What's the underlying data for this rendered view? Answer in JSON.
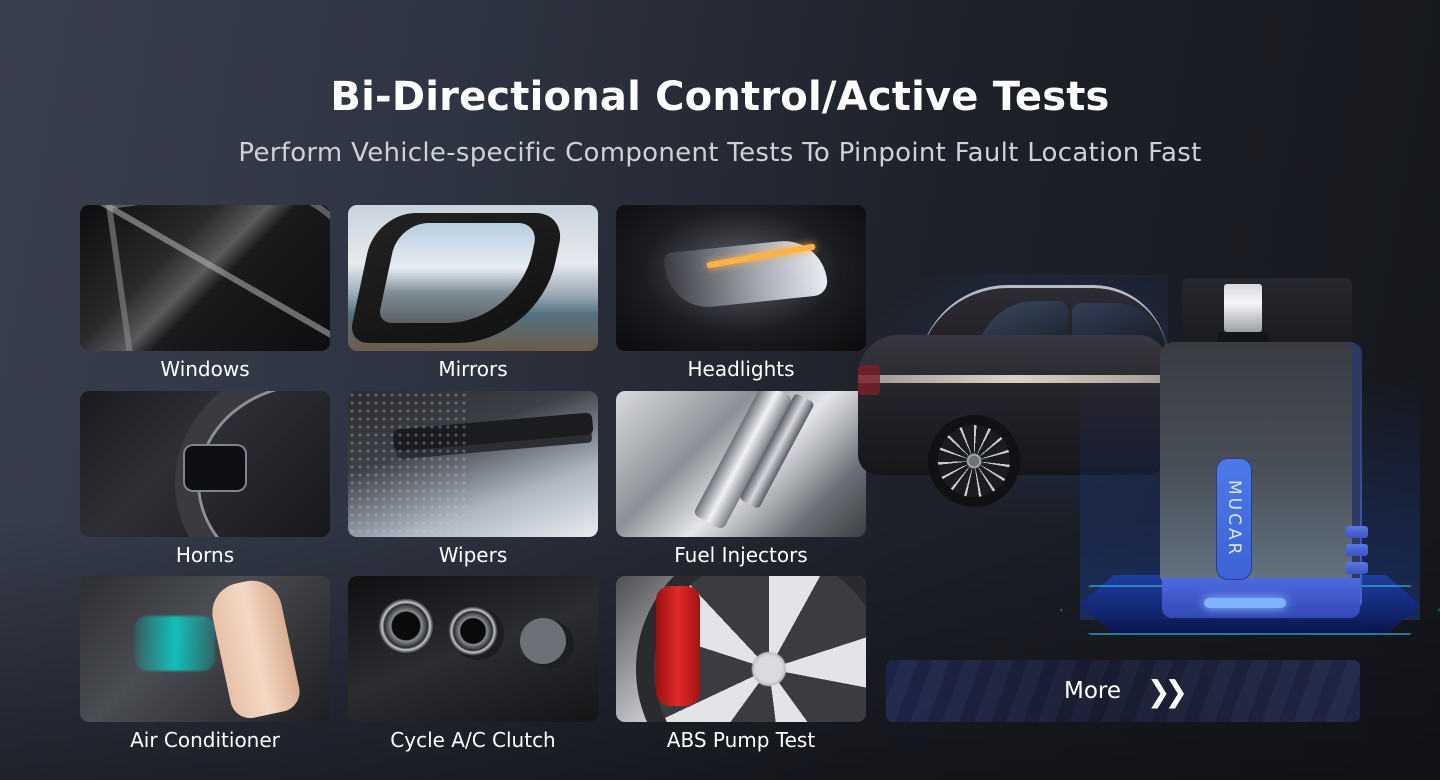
{
  "header": {
    "title": "Bi-Directional Control/Active Tests",
    "subtitle": "Perform Vehicle-specific Component Tests To Pinpoint Fault Location Fast"
  },
  "tests": [
    {
      "label": "Windows",
      "icon": "windows-photo"
    },
    {
      "label": "Mirrors",
      "icon": "mirrors-photo"
    },
    {
      "label": "Headlights",
      "icon": "headlights-photo"
    },
    {
      "label": "Horns",
      "icon": "horns-photo"
    },
    {
      "label": "Wipers",
      "icon": "wipers-photo"
    },
    {
      "label": "Fuel Injectors",
      "icon": "fuel-injectors-photo"
    },
    {
      "label": "Air Conditioner",
      "icon": "air-conditioner-photo"
    },
    {
      "label": "Cycle A/C Clutch",
      "icon": "ac-clutch-photo"
    },
    {
      "label": "ABS Pump Test",
      "icon": "abs-pump-photo"
    }
  ],
  "device": {
    "brand": "MUCAR"
  },
  "more_button": {
    "label": "More",
    "icon": "double-chevron-right",
    "glyph": "❯❯"
  },
  "colors": {
    "background_start": "#3a3f4e",
    "background_end": "#15171c",
    "accent_blue": "#3b64d6",
    "text_primary": "#ffffff",
    "text_secondary": "#cfd1d6"
  }
}
